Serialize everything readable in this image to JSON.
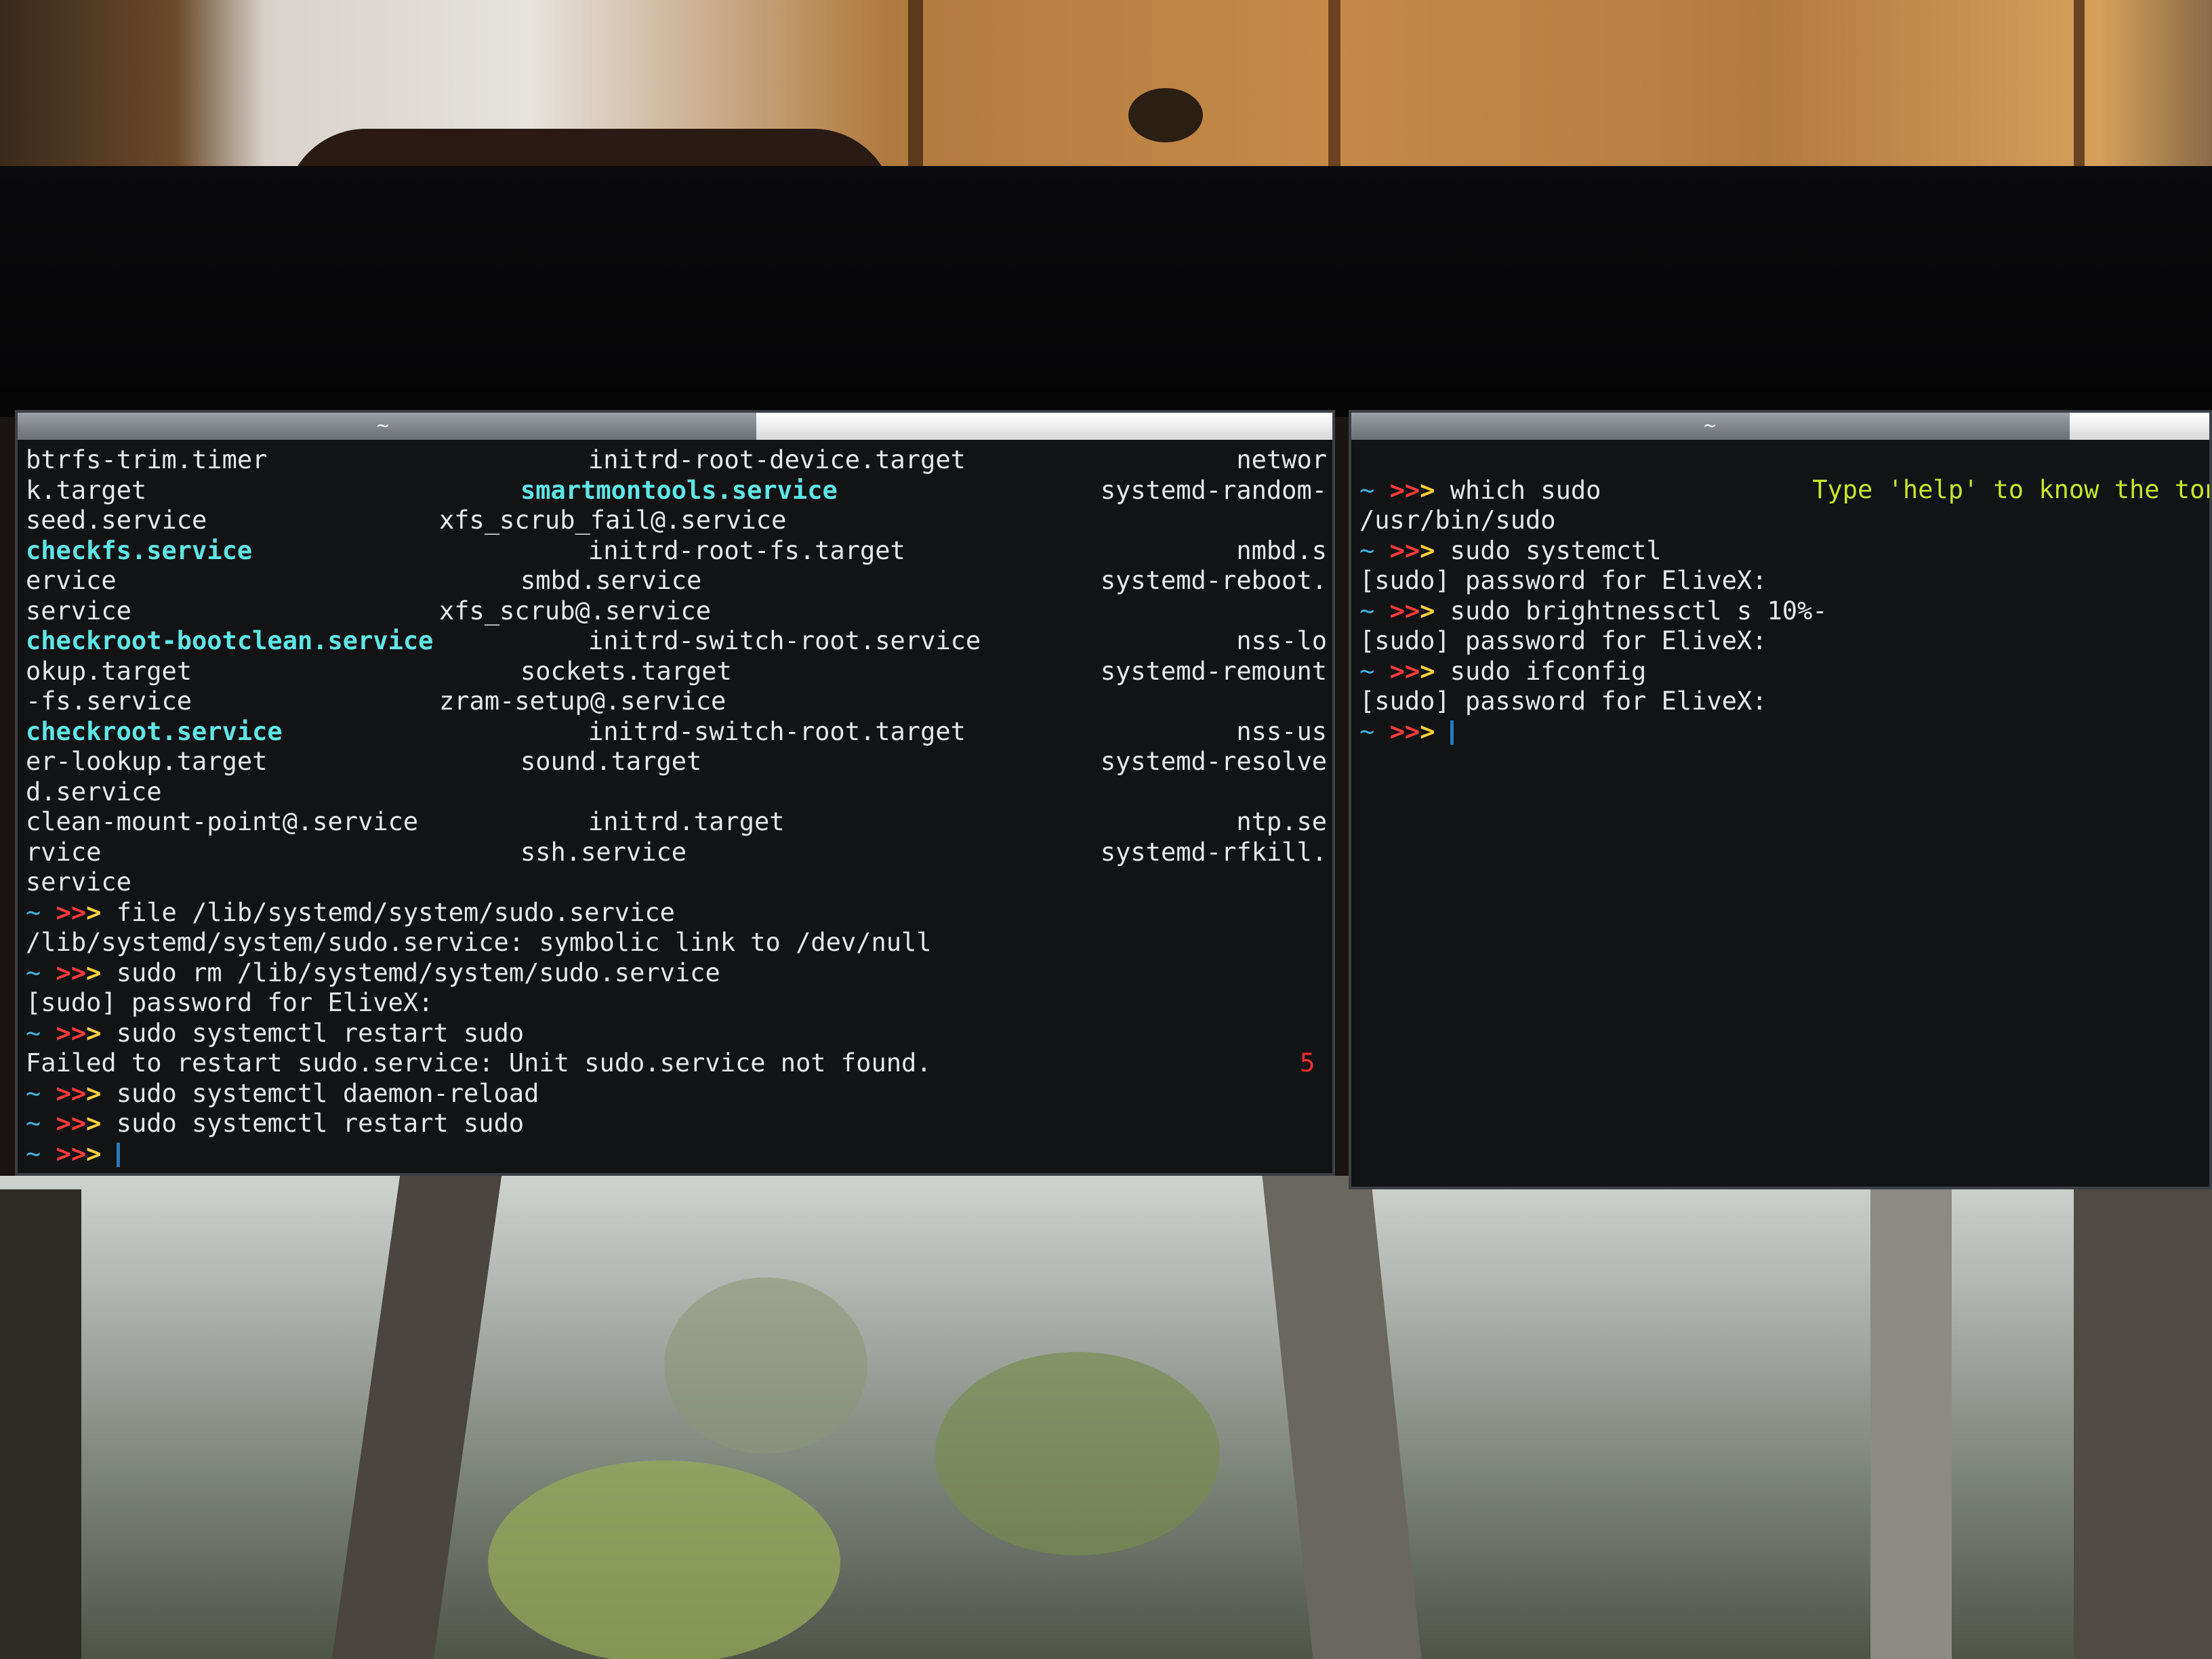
{
  "left_terminal": {
    "tab_label": "~",
    "rows": [
      {
        "c1": "btrfs-trim.timer",
        "c2": "initrd-root-device.target",
        "c3": "networ"
      },
      {
        "c1": "k.target",
        "c2": "smartmontools.service",
        "c2_cyan": true,
        "c3": "systemd-random-"
      },
      {
        "c1": "seed.service",
        "c2": "xfs_scrub_fail@.service",
        "c3": ""
      },
      {
        "c1": "checkfs.service",
        "c1_cyan": true,
        "c2": "initrd-root-fs.target",
        "c3": "nmbd.s"
      },
      {
        "c1": "ervice",
        "c2": "smbd.service",
        "c3": "systemd-reboot."
      },
      {
        "c1": "service",
        "c2": "xfs_scrub@.service",
        "c3": ""
      },
      {
        "c1": "checkroot-bootclean.service",
        "c1_cyan": true,
        "c2": "initrd-switch-root.service",
        "c3": "nss-lo"
      },
      {
        "c1": "okup.target",
        "c2": "sockets.target",
        "c3": "systemd-remount"
      },
      {
        "c1": "-fs.service",
        "c2": "zram-setup@.service",
        "c3": ""
      },
      {
        "c1": "checkroot.service",
        "c1_cyan": true,
        "c2": "initrd-switch-root.target",
        "c3": "nss-us"
      },
      {
        "c1": "er-lookup.target",
        "c2": "sound.target",
        "c3": "systemd-resolve"
      },
      {
        "c1": "d.service",
        "c2": "",
        "c3": ""
      },
      {
        "c1": "clean-mount-point@.service",
        "c2": "initrd.target",
        "c3": "ntp.se"
      },
      {
        "c1": "rvice",
        "c2": "ssh.service",
        "c3": "systemd-rfkill."
      },
      {
        "c1": "service",
        "c2": "",
        "c3": ""
      }
    ],
    "history": [
      {
        "type": "prompt",
        "cmd": "file /lib/systemd/system/sudo.service"
      },
      {
        "type": "output",
        "text": "/lib/systemd/system/sudo.service: symbolic link to /dev/null"
      },
      {
        "type": "prompt",
        "cmd": "sudo rm /lib/systemd/system/sudo.service"
      },
      {
        "type": "output",
        "text": "[sudo] password for EliveX:"
      },
      {
        "type": "prompt",
        "cmd": "sudo systemctl restart sudo"
      },
      {
        "type": "output",
        "text": "Failed to restart sudo.service: Unit sudo.service not found.",
        "code": "5"
      },
      {
        "type": "prompt",
        "cmd": "sudo systemctl daemon-reload"
      },
      {
        "type": "prompt",
        "cmd": "sudo systemctl restart sudo"
      },
      {
        "type": "prompt",
        "cmd": ""
      }
    ]
  },
  "right_terminal": {
    "tab_label": "~",
    "banner": "Type 'help' to know the ton of El",
    "history": [
      {
        "type": "prompt",
        "cmd": "which sudo"
      },
      {
        "type": "output",
        "text": "/usr/bin/sudo"
      },
      {
        "type": "prompt",
        "cmd": "sudo systemctl"
      },
      {
        "type": "output",
        "text": "[sudo] password for EliveX:"
      },
      {
        "type": "prompt",
        "cmd": "sudo brightnessctl s 10%-"
      },
      {
        "type": "output",
        "text": "[sudo] password for EliveX:"
      },
      {
        "type": "prompt",
        "cmd": "sudo ifconfig"
      },
      {
        "type": "output",
        "text": "[sudo] password for EliveX:"
      },
      {
        "type": "prompt",
        "cmd": ""
      }
    ]
  },
  "prompt": {
    "tilde": "~",
    "arrows": ">>",
    "arrow3": ">"
  },
  "colors": {
    "terminal_bg": "#121315",
    "text": "#e8e8e8",
    "highlight": "#5fe6e6",
    "prompt_tilde": "#3fb6e0",
    "prompt_arrows": "#ff3a3a",
    "prompt_arrow_last": "#ffd23a",
    "banner": "#c8e62a",
    "error_code": "#ff2a2a"
  }
}
